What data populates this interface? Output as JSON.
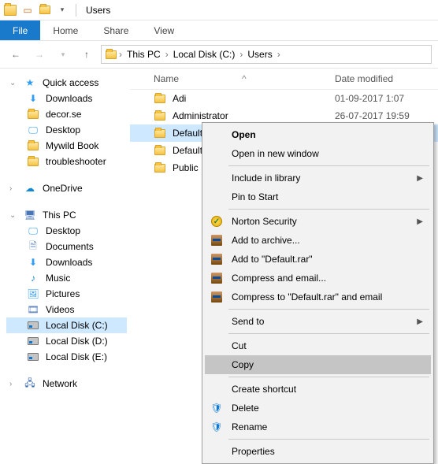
{
  "titlebar": {
    "title": "Users"
  },
  "ribbon": {
    "file": "File",
    "home": "Home",
    "share": "Share",
    "view": "View"
  },
  "breadcrumb": {
    "root": "This PC",
    "c": "Local Disk (C:)",
    "users": "Users"
  },
  "tree": {
    "quick_access": "Quick access",
    "qa_items": [
      "Downloads",
      "decor.se",
      "Desktop",
      "Mywild Book",
      "troubleshooter"
    ],
    "onedrive": "OneDrive",
    "this_pc": "This PC",
    "pc_items": [
      "Desktop",
      "Documents",
      "Downloads",
      "Music",
      "Pictures",
      "Videos",
      "Local Disk (C:)",
      "Local Disk (D:)",
      "Local Disk (E:)"
    ],
    "network": "Network"
  },
  "list": {
    "header_name": "Name",
    "header_date": "Date modified",
    "rows": [
      {
        "name": "Adi",
        "date": "01-09-2017 1:07"
      },
      {
        "name": "Administrator",
        "date": "26-07-2017 19:59"
      },
      {
        "name": "Default",
        "date": ""
      },
      {
        "name": "Default.mi",
        "date": ""
      },
      {
        "name": "Public",
        "date": ""
      }
    ]
  },
  "menu": {
    "open": "Open",
    "open_new": "Open in new window",
    "include": "Include in library",
    "pin": "Pin to Start",
    "norton": "Norton Security",
    "add_archive": "Add to archive...",
    "add_rar": "Add to \"Default.rar\"",
    "compress_email": "Compress and email...",
    "compress_to": "Compress to \"Default.rar\" and email",
    "send_to": "Send to",
    "cut": "Cut",
    "copy": "Copy",
    "shortcut": "Create shortcut",
    "delete": "Delete",
    "rename": "Rename",
    "properties": "Properties"
  }
}
